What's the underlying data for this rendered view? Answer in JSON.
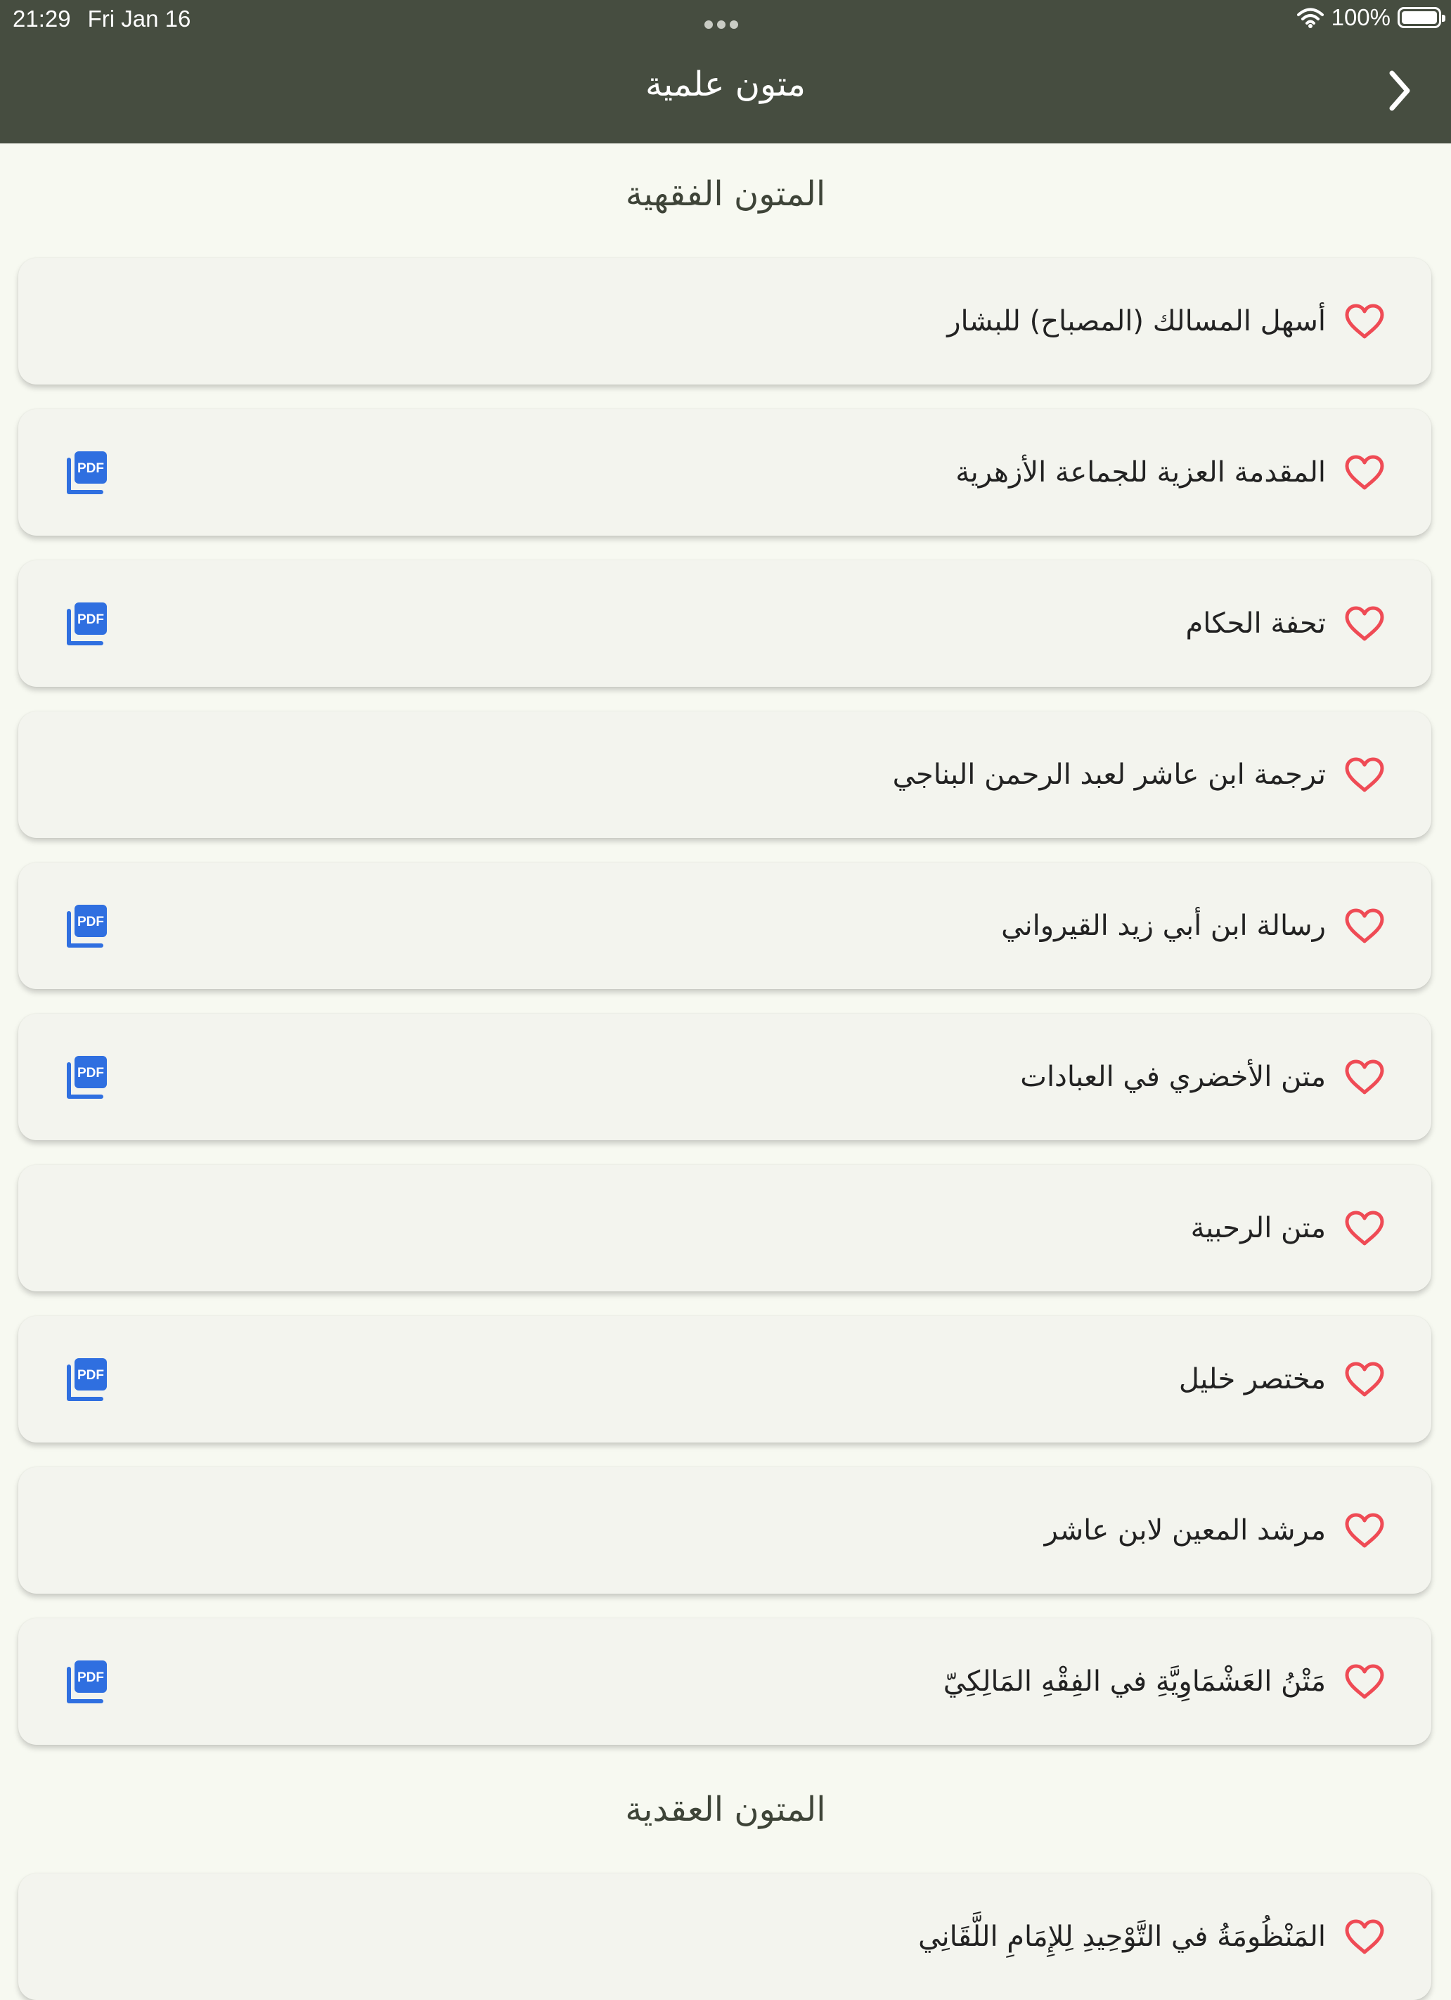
{
  "status_bar": {
    "time": "21:29",
    "date": "Fri Jan 16",
    "battery": "100%",
    "battery_level": 1.0
  },
  "header": {
    "title": "متون علمية",
    "back_icon": "chevron-right-icon"
  },
  "sections": [
    {
      "title": "المتون الفقهية",
      "items": [
        {
          "title": "أسهل المسالك (المصباح) للبشار",
          "pdf": false
        },
        {
          "title": "المقدمة العزية للجماعة الأزهرية",
          "pdf": true
        },
        {
          "title": "تحفة الحكام",
          "pdf": true
        },
        {
          "title": "ترجمة ابن عاشر  لعبد الرحمن البناجي",
          "pdf": false
        },
        {
          "title": "رسالة ابن أبي زيد القيرواني",
          "pdf": true
        },
        {
          "title": "متن الأخضري في العبادات",
          "pdf": true
        },
        {
          "title": "متن الرحبية",
          "pdf": false
        },
        {
          "title": "مختصر خليل",
          "pdf": true
        },
        {
          "title": "مرشد المعين لابن عاشر",
          "pdf": false
        },
        {
          "title": "مَتْنُ العَشْمَاوِيَّةِ في الفِقْهِ المَالِكِيّ",
          "pdf": true
        }
      ]
    },
    {
      "title": "المتون العقدية",
      "items": [
        {
          "title": "المَنْظُومَةُ في التَّوْحِيدِ لِلإِمَامِ اللَّقَانِي",
          "pdf": false
        }
      ]
    }
  ],
  "icons": {
    "favorite": "heart-outline-icon",
    "pdf": "pdf-icon"
  },
  "colors": {
    "header_bg": "#464d40",
    "page_bg": "#f7f9f1",
    "card_bg": "#f3f4ee",
    "heart": "#ef4b55",
    "pdf": "#2f6fe0"
  }
}
